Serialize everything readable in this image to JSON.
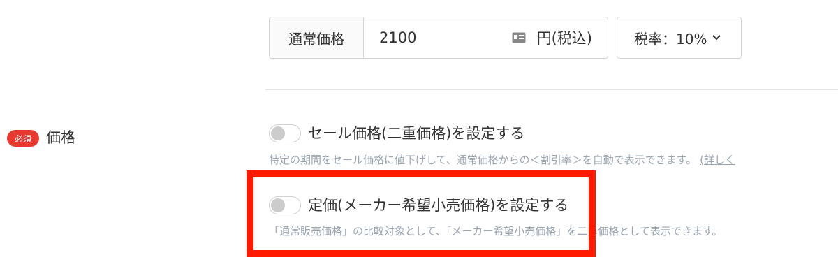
{
  "price": {
    "label": "通常価格",
    "value": "2100",
    "unit": "円(税込)",
    "icon": "card-icon"
  },
  "tax": {
    "label": "税率：10%",
    "icon": "chevron-down-icon"
  },
  "field": {
    "required_badge": "必須",
    "label": "価格"
  },
  "sale_toggle": {
    "label": "セール価格(二重価格)を設定する",
    "help": "特定の期間をセール価格に値下げして、通常価格からの＜割引率＞を自動で表示できます。",
    "help_link": "(詳しく"
  },
  "list_price_toggle": {
    "label": "定価(メーカー希望小売価格)を設定する",
    "help": "「通常販売価格」の比較対象として、「メーカー希望小売価格」を二重価格として表示できます。"
  },
  "colors": {
    "required": "#e8382f",
    "highlight": "#ff1a00",
    "help_text": "#9aa5b1"
  }
}
